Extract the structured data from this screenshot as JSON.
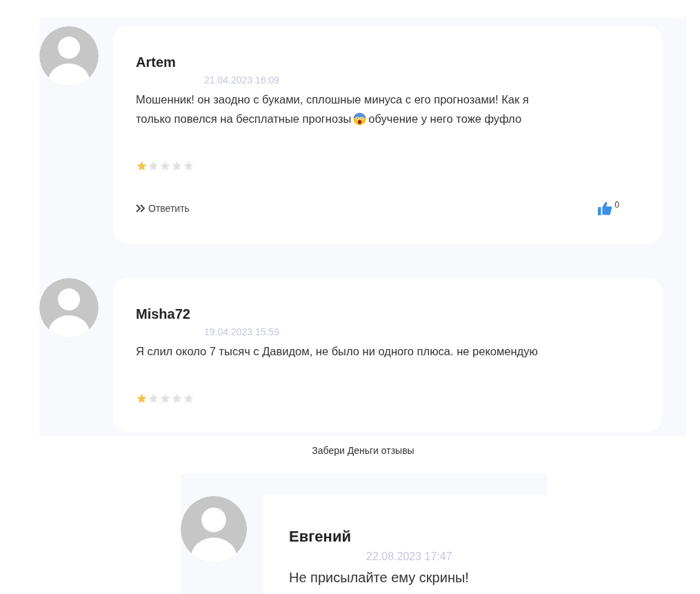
{
  "reviews": [
    {
      "author": "Artem",
      "date": "21.04.2023 16:09",
      "body": [
        [
          {
            "kind": "text",
            "text": "Мошенник! он заодно с буками, сплошные минуса с его прогнозами! Как я"
          }
        ],
        [
          {
            "kind": "text",
            "text": "только повелся на бесплатные прогнозы"
          },
          {
            "kind": "emoji"
          },
          {
            "kind": "text",
            "text": "обучение у него тоже фуфло"
          }
        ]
      ],
      "stars": 1,
      "reply": "Ответить",
      "likes": "0"
    },
    {
      "author": "Misha72",
      "date": "19.04.2023 15:59",
      "body": [
        [
          {
            "kind": "text",
            "text": "Я слил около 7 тысяч с Давидом, не было ни одного плюса. не рекомендую"
          }
        ]
      ],
      "stars": 1
    }
  ],
  "caption": "Забери Деньги отзывы",
  "second_image": {
    "author": "Евгений",
    "date": "22.08.2023 17:47",
    "body": "Не присылайте ему скрины!"
  }
}
